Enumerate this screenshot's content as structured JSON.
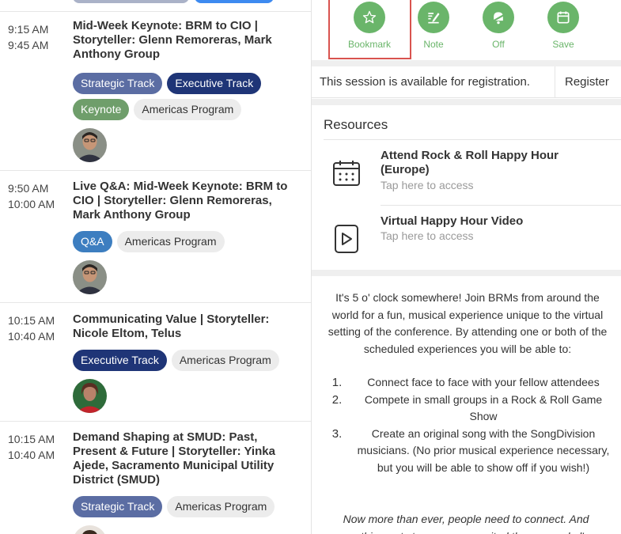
{
  "sessions": [
    {
      "start": "9:15 AM",
      "end": "9:45 AM",
      "title": "Mid-Week Keynote: BRM to CIO | Storyteller: Glenn Remoreras, Mark Anthony Group",
      "tags": [
        "Strategic Track",
        "Executive Track",
        "Keynote",
        "Americas Program"
      ]
    },
    {
      "start": "9:50 AM",
      "end": "10:00 AM",
      "title": "Live Q&A: Mid-Week Keynote: BRM to CIO | Storyteller: Glenn Remoreras, Mark Anthony Group",
      "tags": [
        "Q&A",
        "Americas Program"
      ]
    },
    {
      "start": "10:15 AM",
      "end": "10:40 AM",
      "title": "Communicating Value | Storyteller: Nicole Eltom, Telus",
      "tags": [
        "Executive Track",
        "Americas Program"
      ]
    },
    {
      "start": "10:15 AM",
      "end": "10:40 AM",
      "title": "Demand Shaping at SMUD: Past, Present & Future | Storyteller: Yinka Ajede, Sacramento Municipal Utility District (SMUD)",
      "tags": [
        "Strategic Track",
        "Americas Program"
      ]
    }
  ],
  "actions": [
    {
      "label": "Bookmark",
      "icon": "star-icon"
    },
    {
      "label": "Note",
      "icon": "note-icon"
    },
    {
      "label": "Off",
      "icon": "alarm-off-icon"
    },
    {
      "label": "Save",
      "icon": "calendar-icon"
    }
  ],
  "registration": {
    "message": "This session is available for registration.",
    "button": "Register"
  },
  "resources": {
    "heading": "Resources",
    "items": [
      {
        "title": "Attend Rock & Roll Happy Hour (Europe)",
        "subtitle": "Tap here to access",
        "icon": "calendar-grid-icon"
      },
      {
        "title": "Virtual Happy Hour Video",
        "subtitle": "Tap here to access",
        "icon": "video-play-icon"
      }
    ]
  },
  "description": {
    "intro": "It's 5 o' clock somewhere! Join BRMs from around the world for a fun, musical experience unique to the virtual setting of the conference. By attending one or both of the scheduled experiences you will be able to:",
    "steps": [
      {
        "n": "1.",
        "text": "Connect face to face with your fellow attendees"
      },
      {
        "n": "2.",
        "text": "Compete in small groups in a Rock & Roll Game Show"
      },
      {
        "n": "3.",
        "text": "Create an original song with the SongDivision musicians. (No prior musical experience necessary, but you will be able to show off if you wish!)"
      }
    ],
    "closing": "Now more than ever, people need to connect. And nothing gets teams more excited than a good ol'"
  },
  "colors": {
    "accent_green": "#6ab56a",
    "highlight_red": "#d9534f",
    "strategic": "#5b6da3",
    "executive": "#1f3577",
    "keynote": "#6f9e6b",
    "qa": "#3d7ec0"
  }
}
